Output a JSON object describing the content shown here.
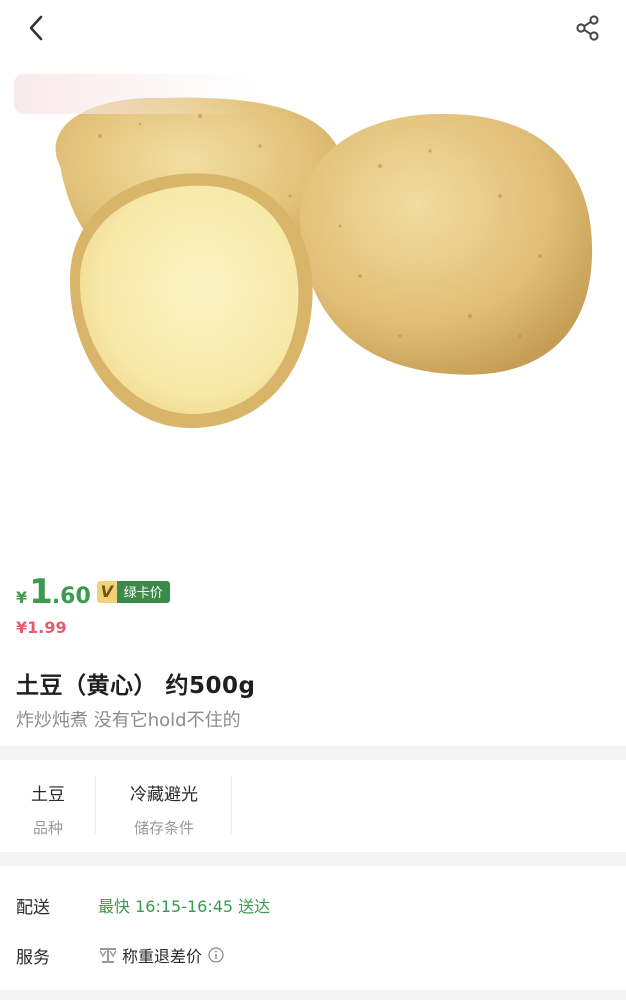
{
  "nav": {
    "back_icon": "chevron-left-icon",
    "share_icon": "share-icon"
  },
  "price": {
    "currency": "¥",
    "integer": "1",
    "decimal": ".60",
    "badge_letter": "V",
    "badge_label": "绿卡价",
    "original": "¥1.99"
  },
  "product": {
    "title": "土豆（黄心） 约500g",
    "subtitle": "炸炒炖煮 没有它hold不住的"
  },
  "attributes": [
    {
      "value": "土豆",
      "key": "品种"
    },
    {
      "value": "冷藏避光",
      "key": "储存条件"
    }
  ],
  "delivery": {
    "label": "配送",
    "text": "最快 16:15-16:45 送达"
  },
  "service": {
    "label": "服务",
    "text": "称重退差价",
    "icon": "scale-icon",
    "info_icon": "info-icon"
  },
  "colors": {
    "accent_green": "#3c9a4f",
    "original_price_red": "#e35d6a",
    "badge_gold": "#f1d27a",
    "badge_green": "#3b8a4a"
  }
}
